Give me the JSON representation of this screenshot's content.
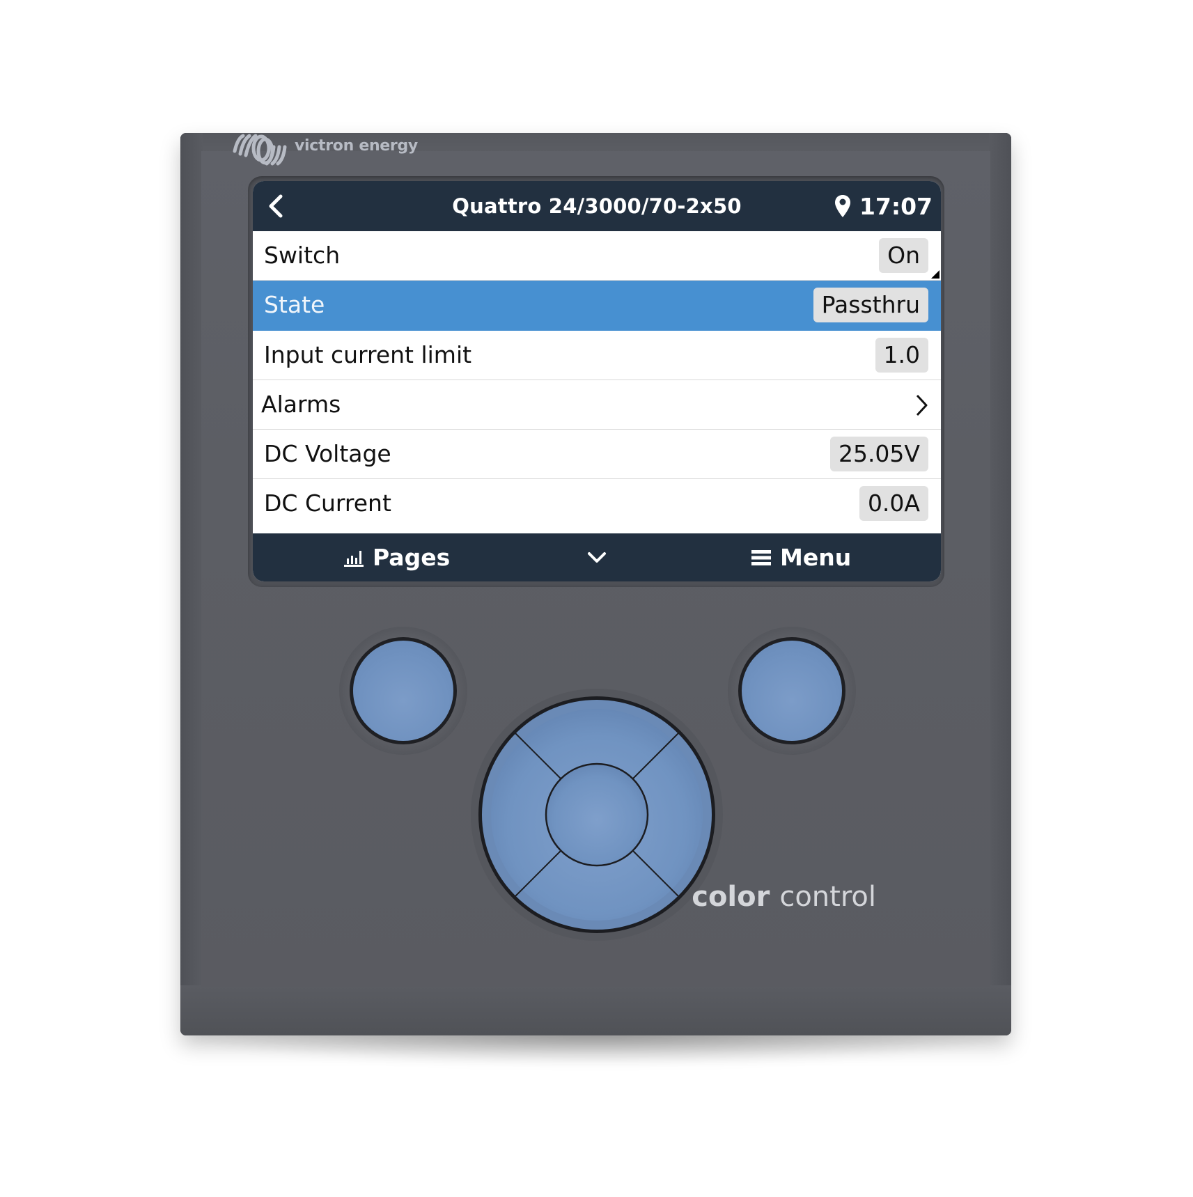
{
  "device": {
    "brand_logo_text": "victron energy",
    "product_name_bold": "color",
    "product_name_light": "control"
  },
  "header": {
    "back_icon": "chevron-left-icon",
    "title": "Quattro 24/3000/70-2x50",
    "location_icon": "map-pin-icon",
    "time": "17:07"
  },
  "rows": [
    {
      "label": "Switch",
      "value": "On",
      "type": "value"
    },
    {
      "label": "State",
      "value": "Passthru",
      "type": "value",
      "selected": true
    },
    {
      "label": "Input current limit",
      "value": "1.0",
      "type": "value"
    },
    {
      "label": "Alarms",
      "type": "submenu",
      "icon": "chevron-right-icon"
    },
    {
      "label": "DC Voltage",
      "value": "25.05V",
      "type": "value"
    },
    {
      "label": "DC Current",
      "value": "0.0A",
      "type": "value"
    }
  ],
  "footer": {
    "pages_icon": "bar-chart-icon",
    "pages_label": "Pages",
    "scroll_icon": "chevron-down-icon",
    "menu_icon": "hamburger-menu-icon",
    "menu_label": "Menu"
  },
  "hardware_buttons": [
    "left-button",
    "right-button",
    "dpad-up",
    "dpad-down",
    "dpad-left",
    "dpad-right",
    "dpad-center"
  ],
  "colors": {
    "header_bg": "#223040",
    "selection": "#4790d1",
    "badge_bg": "#e1e1e1",
    "device_body": "#5a5c62",
    "button_blue": "#7092c0"
  }
}
